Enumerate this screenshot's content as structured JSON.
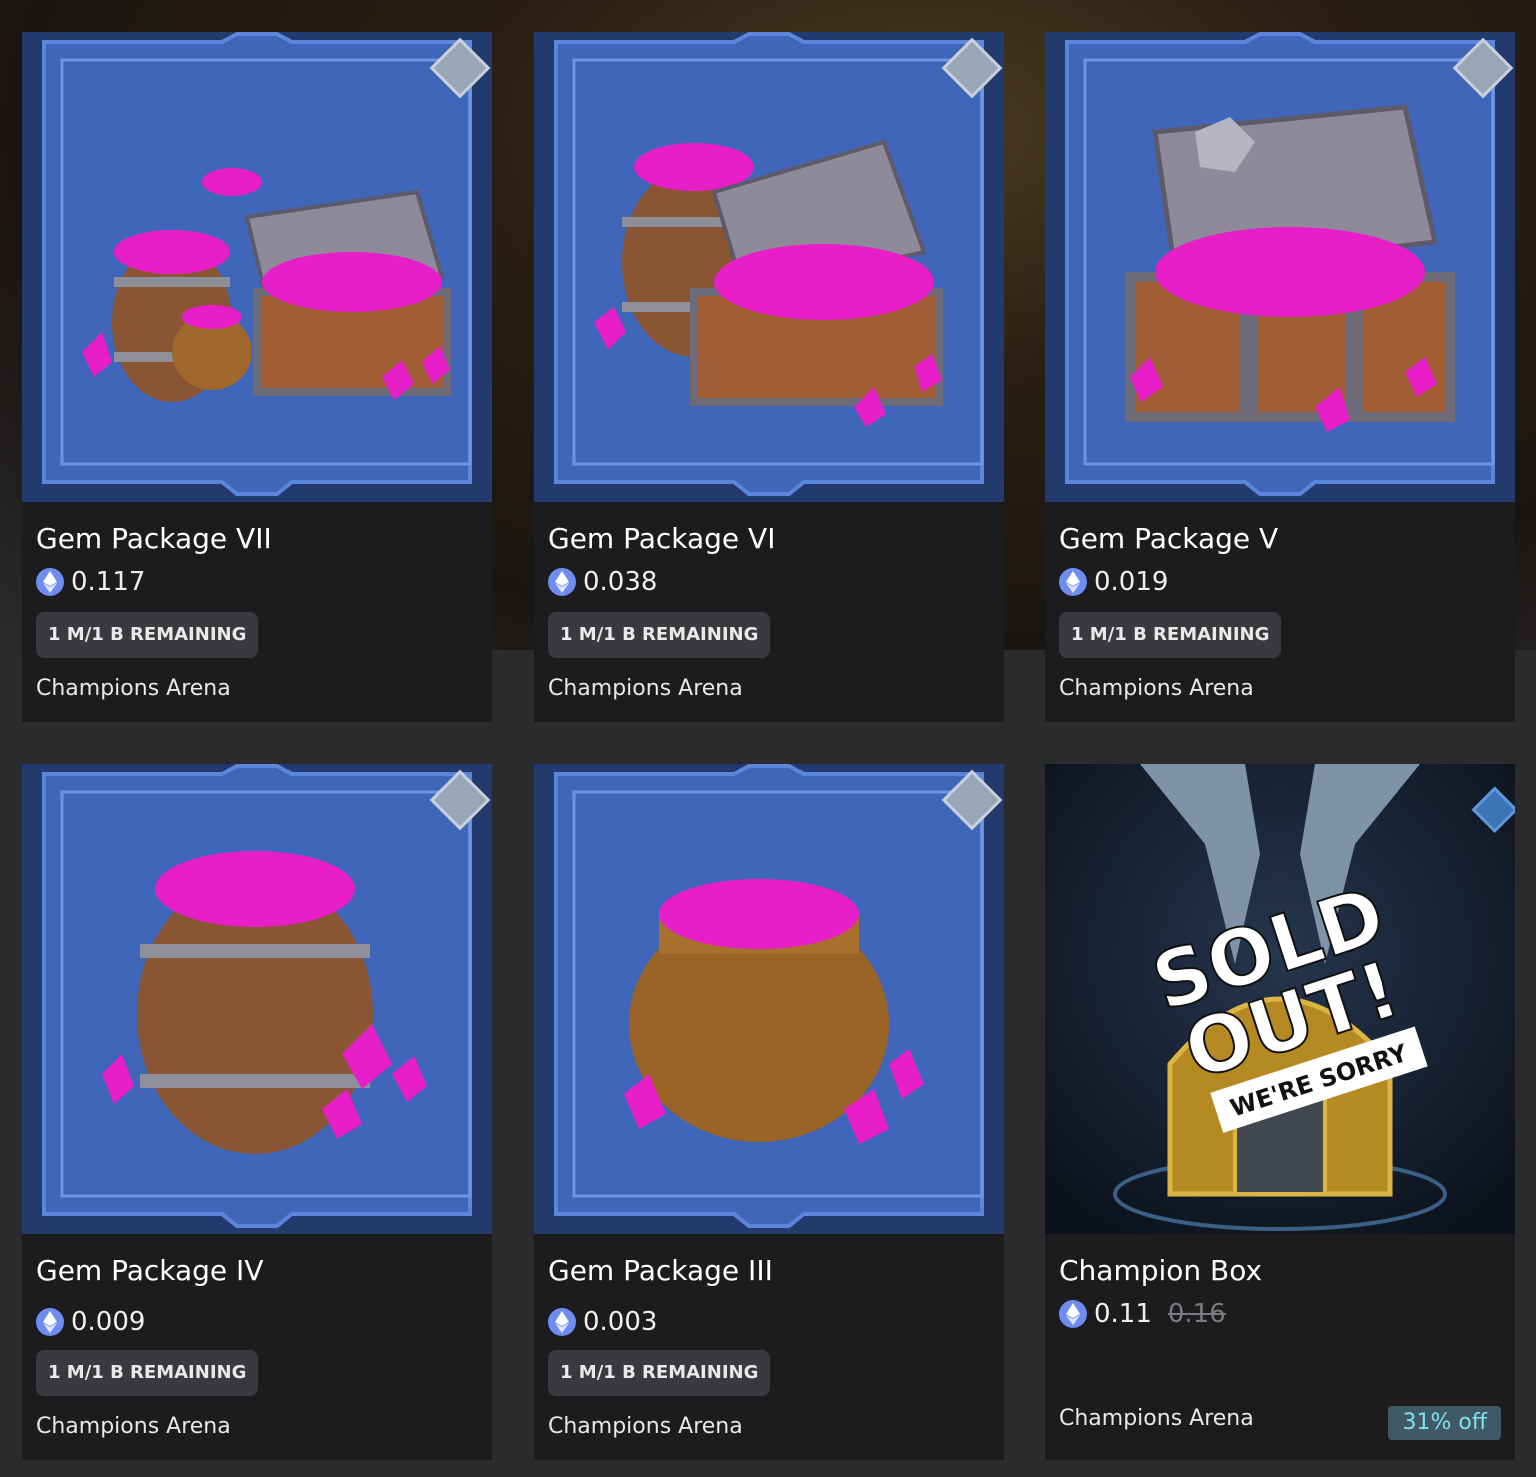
{
  "colors": {
    "page_bg": "#2b2b2e",
    "card_bg": "#1c1c1f",
    "badge_bg": "#3a3a3e",
    "eth_icon": "#6f8df0",
    "gem_pink": "#e81fc9",
    "frame_blue": "#3f66b8",
    "discount_text": "#7fe0ee"
  },
  "cards": [
    {
      "title": "Gem Package VII",
      "price": "0.117",
      "badge": "1 M/1 B REMAINING",
      "collection": "Champions Arena",
      "image_icon": "treasure-chest-barrel-pot-icon"
    },
    {
      "title": "Gem Package VI",
      "price": "0.038",
      "badge": "1 M/1 B REMAINING",
      "collection": "Champions Arena",
      "image_icon": "treasure-chest-barrel-icon"
    },
    {
      "title": "Gem Package V",
      "price": "0.019",
      "badge": "1 M/1 B REMAINING",
      "collection": "Champions Arena",
      "image_icon": "treasure-chest-icon"
    },
    {
      "title": "Gem Package IV",
      "price": "0.009",
      "badge": "1 M/1 B REMAINING",
      "collection": "Champions Arena",
      "image_icon": "gem-barrel-icon"
    },
    {
      "title": "Gem Package III",
      "price": "0.003",
      "badge": "1 M/1 B REMAINING",
      "collection": "Champions Arena",
      "image_icon": "gem-pot-icon"
    },
    {
      "title": "Champion Box",
      "price": "0.11",
      "old_price": "0.16",
      "collection": "Champions Arena",
      "discount": "31% off",
      "image_icon": "champion-box-icon",
      "overlay": {
        "line1": "SOLD",
        "line2": "OUT!",
        "ribbon": "WE'RE SORRY"
      }
    }
  ]
}
